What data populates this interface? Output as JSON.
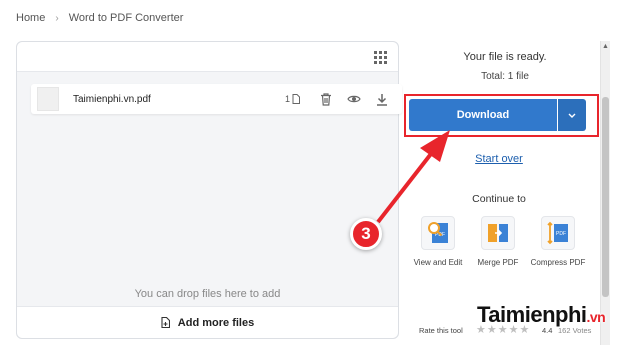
{
  "breadcrumb": {
    "home": "Home",
    "current": "Word to PDF Converter"
  },
  "file": {
    "name": "Taimienphi.vn.pdf",
    "pages": "1"
  },
  "drop_hint": "You can drop files here to add",
  "add_more": "Add more files",
  "status": {
    "ready": "Your file is ready.",
    "total": "Total: 1 file"
  },
  "download": {
    "label": "Download"
  },
  "start_over": "Start over",
  "continue_to": "Continue to",
  "tools": [
    {
      "label": "View and Edit",
      "icon": "view-edit-pdf-icon"
    },
    {
      "label": "Merge PDF",
      "icon": "merge-pdf-icon"
    },
    {
      "label": "Compress PDF",
      "icon": "compress-pdf-icon"
    }
  ],
  "rating": {
    "label": "Rate this tool",
    "score": "4.4",
    "votes": "162 Votes",
    "stars": "★★★★★"
  },
  "annotation": {
    "step": "3"
  },
  "watermark": {
    "brand": "Taimienphi",
    "tld": ".vn"
  },
  "colors": {
    "accent": "#3179cc",
    "highlight": "#e8252c",
    "link": "#1d5fae"
  }
}
